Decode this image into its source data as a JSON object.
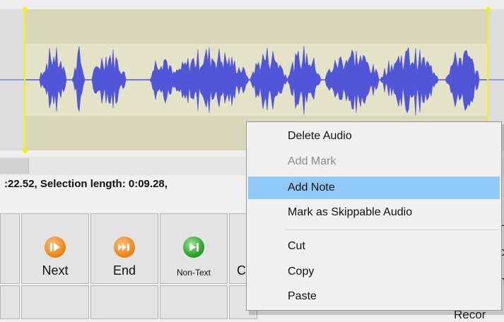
{
  "status": {
    "text": ":22.52, Selection length: 0:09.28,"
  },
  "transport": {
    "buttons": [
      {
        "id": "next",
        "label": "Next",
        "icon": "next-icon",
        "color": "#f08a1a"
      },
      {
        "id": "end",
        "label": "End",
        "icon": "end-icon",
        "color": "#f08a1a"
      },
      {
        "id": "non-text",
        "label": "Non-Text",
        "icon": "non-text-icon",
        "color": "#2aa628"
      }
    ],
    "partial_label": "C"
  },
  "edge_texts": [
    "L",
    "c",
    "h",
    "Recor"
  ],
  "context_menu": {
    "items": [
      {
        "label": "Delete Audio",
        "enabled": true
      },
      {
        "label": "Add Mark",
        "enabled": false
      },
      {
        "label": "Add Note",
        "enabled": true,
        "highlighted": true
      },
      {
        "label": "Mark as Skippable Audio",
        "enabled": true
      },
      {
        "label": "Cut",
        "enabled": true
      },
      {
        "label": "Copy",
        "enabled": true
      },
      {
        "label": "Paste",
        "enabled": true
      }
    ]
  },
  "colors": {
    "waveform": "#5156d8",
    "selection": "#d8d7b9",
    "selection_markers": "#f2f20a",
    "menu_highlight": "#91c9f7"
  }
}
